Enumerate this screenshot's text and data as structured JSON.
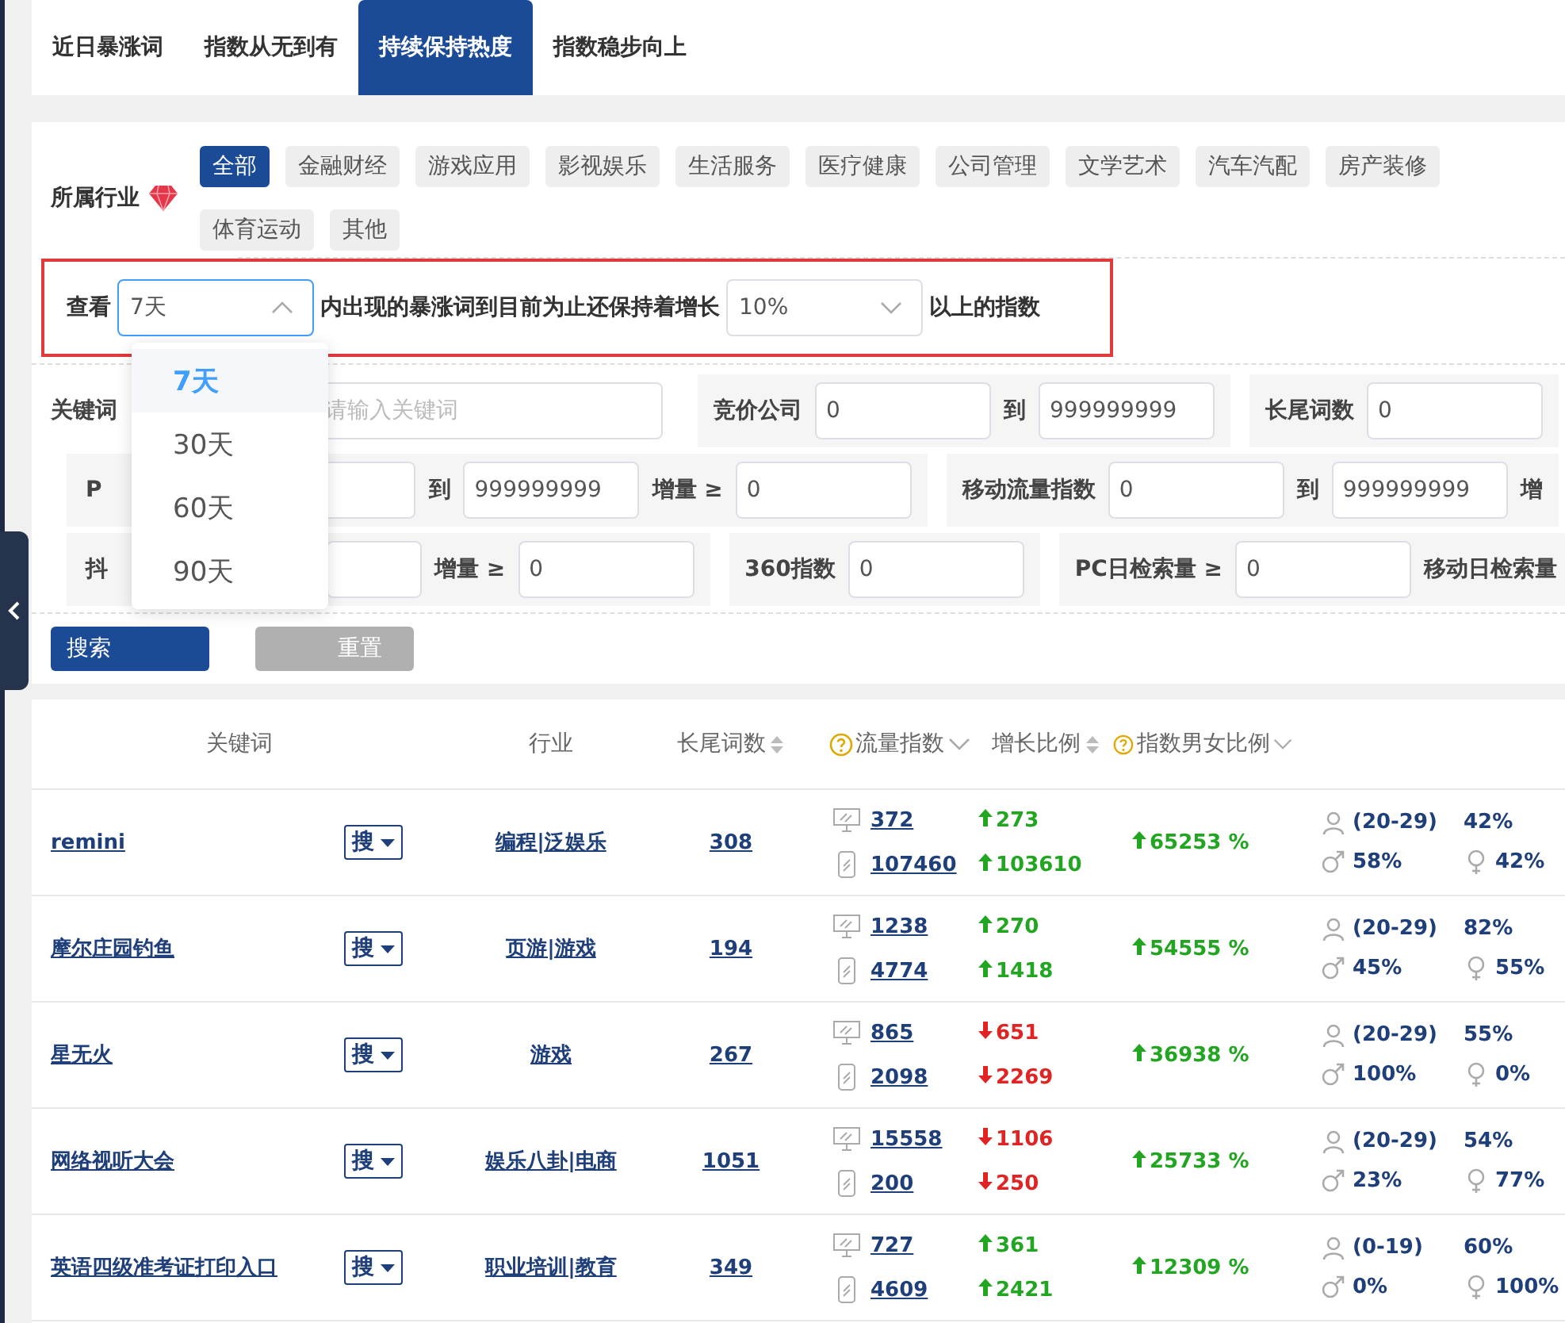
{
  "tabs": [
    {
      "label": "近日暴涨词",
      "selected": false
    },
    {
      "label": "指数从无到有",
      "selected": false
    },
    {
      "label": "持续保持热度",
      "selected": true
    },
    {
      "label": "指数稳步向上",
      "selected": false
    }
  ],
  "industry": {
    "label": "所属行业",
    "tags": [
      {
        "label": "全部",
        "selected": true
      },
      {
        "label": "金融财经",
        "selected": false
      },
      {
        "label": "游戏应用",
        "selected": false
      },
      {
        "label": "影视娱乐",
        "selected": false
      },
      {
        "label": "生活服务",
        "selected": false
      },
      {
        "label": "医疗健康",
        "selected": false
      },
      {
        "label": "公司管理",
        "selected": false
      },
      {
        "label": "文学艺术",
        "selected": false
      },
      {
        "label": "汽车汽配",
        "selected": false
      },
      {
        "label": "房产装修",
        "selected": false
      },
      {
        "label": "体育运动",
        "selected": false
      },
      {
        "label": "其他",
        "selected": false
      }
    ]
  },
  "period_filter": {
    "prefix": "查看",
    "period": {
      "value": "7天",
      "open": true,
      "options": [
        {
          "label": "7天",
          "selected": true
        },
        {
          "label": "30天",
          "selected": false
        },
        {
          "label": "60天",
          "selected": false
        },
        {
          "label": "90天",
          "selected": false
        }
      ]
    },
    "middle": "内出现的暴涨词到目前为止还保持着增长",
    "growth": {
      "value": "10%",
      "open": false
    },
    "suffix": "以上的指数"
  },
  "field_rows": [
    [
      {
        "fields": [
          {
            "label": "关键词",
            "kind": "input",
            "placeholder": "请输入关键词"
          }
        ]
      },
      {
        "fields": [
          {
            "label": "竞价公司",
            "kind": "input",
            "value": "0"
          },
          {
            "label": "到",
            "kind": "input",
            "value": "999999999"
          }
        ]
      },
      {
        "fields": [
          {
            "label": "长尾词数",
            "kind": "input",
            "value": "0"
          }
        ]
      }
    ],
    [
      {
        "fields": [
          {
            "label": "P",
            "kind": "input"
          },
          {
            "label": "到",
            "kind": "input",
            "value": "999999999"
          },
          {
            "label": "增量 ≥",
            "kind": "input",
            "value": "0"
          }
        ]
      },
      {
        "fields": [
          {
            "label": "移动流量指数",
            "kind": "input",
            "value": "0"
          },
          {
            "label": "到",
            "kind": "input",
            "value": "999999999"
          },
          {
            "label": "增",
            "kind": "label"
          }
        ]
      }
    ],
    [
      {
        "fields": [
          {
            "label": "抖",
            "kind": "input"
          },
          {
            "label": "增量 ≥",
            "kind": "input",
            "value": "0"
          }
        ]
      },
      {
        "fields": [
          {
            "label": "360指数",
            "kind": "input",
            "value": "0"
          }
        ]
      },
      {
        "fields": [
          {
            "label": "PC日检索量 ≥",
            "kind": "input",
            "value": "0"
          },
          {
            "label": "移动日检索量",
            "kind": "label"
          }
        ]
      }
    ]
  ],
  "buttons": {
    "search": "搜索",
    "reset": "重置"
  },
  "table": {
    "columns": [
      {
        "label": "关键词",
        "kind": "plain"
      },
      {
        "label": "行业",
        "kind": "plain"
      },
      {
        "label": "长尾词数",
        "kind": "sortable"
      },
      {
        "label": "流量指数",
        "kind": "help_menu"
      },
      {
        "label": "增长比例",
        "kind": "sortable"
      },
      {
        "label": "指数男女比例",
        "kind": "help_menu"
      }
    ],
    "rows": [
      {
        "keyword": "remini",
        "search": "搜",
        "industry": "编程|泛娱乐",
        "longtail": "308",
        "pc": "372",
        "mobile": "107460",
        "pc_change": {
          "value": "273",
          "rising": true
        },
        "mobile_change": {
          "value": "103610",
          "rising": true
        },
        "growth": "65253 %",
        "age": "(20-29)",
        "age_pct": "42%",
        "male": "58%",
        "female": "42%"
      },
      {
        "keyword": "摩尔庄园钓鱼",
        "search": "搜",
        "industry": "页游|游戏",
        "longtail": "194",
        "pc": "1238",
        "mobile": "4774",
        "pc_change": {
          "value": "270",
          "rising": true
        },
        "mobile_change": {
          "value": "1418",
          "rising": true
        },
        "growth": "54555 %",
        "age": "(20-29)",
        "age_pct": "82%",
        "male": "45%",
        "female": "55%"
      },
      {
        "keyword": "星无火",
        "search": "搜",
        "industry": "游戏",
        "longtail": "267",
        "pc": "865",
        "mobile": "2098",
        "pc_change": {
          "value": "651",
          "rising": false
        },
        "mobile_change": {
          "value": "2269",
          "rising": false
        },
        "growth": "36938 %",
        "age": "(20-29)",
        "age_pct": "55%",
        "male": "100%",
        "female": "0%"
      },
      {
        "keyword": "网络视听大会",
        "search": "搜",
        "industry": "娱乐八卦|电商",
        "longtail": "1051",
        "pc": "15558",
        "mobile": "200",
        "pc_change": {
          "value": "1106",
          "rising": false
        },
        "mobile_change": {
          "value": "250",
          "rising": false
        },
        "growth": "25733 %",
        "age": "(20-29)",
        "age_pct": "54%",
        "male": "23%",
        "female": "77%"
      },
      {
        "keyword": "英语四级准考证打印入口",
        "search": "搜",
        "industry": "职业培训|教育",
        "longtail": "349",
        "pc": "727",
        "mobile": "4609",
        "pc_change": {
          "value": "361",
          "rising": true
        },
        "mobile_change": {
          "value": "2421",
          "rising": true
        },
        "growth": "12309 %",
        "age": "(0-19)",
        "age_pct": "60%",
        "male": "0%",
        "female": "100%"
      }
    ]
  }
}
